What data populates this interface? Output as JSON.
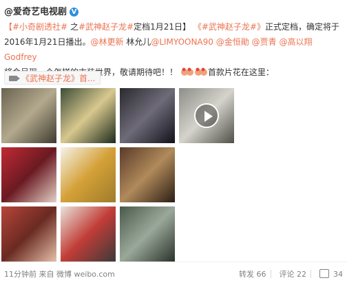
{
  "post": {
    "author": "@爱奇艺电视剧",
    "verified_badge": "V",
    "text_parts": {
      "tag1": "【#小奇剧透社#",
      "zhi": "之",
      "tag2": "#武神赵子龙#",
      "date": "定档1月21日】",
      "tag3": "《#武神赵子龙#》",
      "t1": "正式定档，确定将于",
      "t2": "2016年1月21日播出。",
      "m1": "@林更新",
      "t3": "林允儿",
      "m2": "@LIMYOONA90",
      "m3": "@金恒勛",
      "m4": "@贾青",
      "m5": "@高以翔Godfrey",
      "t4": "将会呈现一个怎样的古装世界，敬请期待吧！！",
      "t5": "首款片花在这里："
    },
    "video_card": {
      "label": "《武神赵子龙》首..."
    },
    "footer": {
      "time": "11分钟前",
      "from": "来自",
      "source": "微博 weibo.com",
      "repost": "转发 66",
      "comment": "评论 22",
      "like": "34"
    },
    "thumbnails": [
      {
        "name": "thumb-1",
        "colors": [
          "#6a6350",
          "#b3a98d",
          "#3e3a2e"
        ]
      },
      {
        "name": "thumb-2",
        "colors": [
          "#3d4c39",
          "#d8c88e",
          "#1d2a1c"
        ]
      },
      {
        "name": "thumb-3",
        "colors": [
          "#2a2a2e",
          "#6e6b78",
          "#11111a"
        ]
      },
      {
        "name": "thumb-4",
        "colors": [
          "#8c8e88",
          "#d5d3cb",
          "#4e4f48"
        ]
      },
      {
        "name": "thumb-5",
        "colors": [
          "#c22a33",
          "#6b1a22",
          "#e3d0c6"
        ]
      },
      {
        "name": "thumb-6",
        "colors": [
          "#f6f2ea",
          "#d4a137",
          "#9e7b2c"
        ]
      },
      {
        "name": "thumb-7",
        "colors": [
          "#5a3a2a",
          "#b08a5a",
          "#2c1d15"
        ]
      },
      {
        "name": "thumb-8",
        "colors": [
          "#b8453a",
          "#6a2a22",
          "#e5c0a8"
        ]
      },
      {
        "name": "thumb-9",
        "colors": [
          "#e8e4dc",
          "#c23d37",
          "#3a3a3a"
        ]
      },
      {
        "name": "thumb-10",
        "colors": [
          "#4a5a4a",
          "#9aa89a",
          "#2a322a"
        ]
      }
    ]
  }
}
